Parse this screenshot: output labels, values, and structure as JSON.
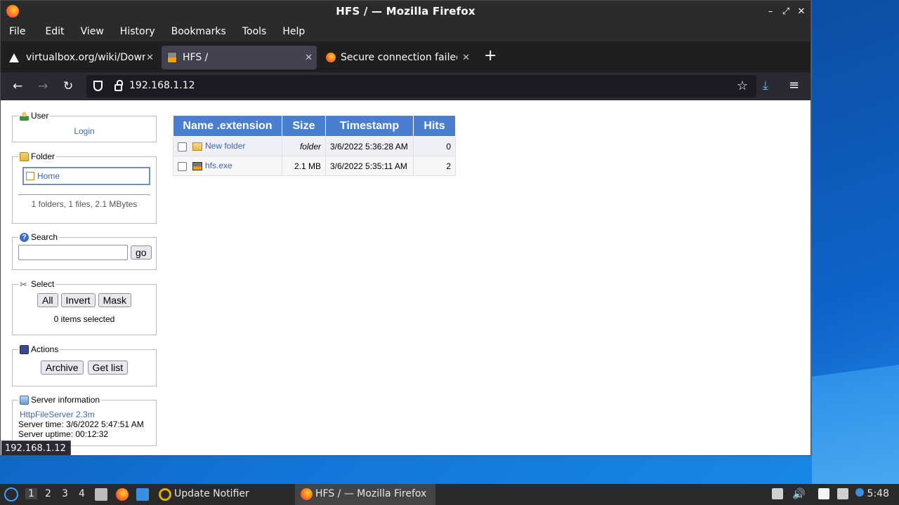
{
  "window": {
    "title": "HFS / — Mozilla Firefox"
  },
  "menu": [
    "File",
    "Edit",
    "View",
    "History",
    "Bookmarks",
    "Tools",
    "Help"
  ],
  "tabs": [
    {
      "label": "virtualbox.org/wiki/Downl"
    },
    {
      "label": "HFS /"
    },
    {
      "label": "Secure connection failed"
    }
  ],
  "address": {
    "url": "192.168.1.12"
  },
  "sidebar": {
    "user": {
      "legend": "User",
      "login": "Login"
    },
    "folder": {
      "legend": "Folder",
      "home": "Home",
      "summary": "1 folders, 1 files, 2.1 MBytes"
    },
    "search": {
      "legend": "Search",
      "go": "go"
    },
    "select": {
      "legend": "Select",
      "all": "All",
      "invert": "Invert",
      "mask": "Mask",
      "status": "0 items selected"
    },
    "actions": {
      "legend": "Actions",
      "archive": "Archive",
      "getlist": "Get list"
    },
    "server": {
      "legend": "Server information",
      "name": "HttpFileServer 2.3m",
      "time": "Server time: 3/6/2022 5:47:51 AM",
      "uptime": "Server uptime: 00:12:32"
    }
  },
  "table": {
    "headers": [
      "Name .extension",
      "Size",
      "Timestamp",
      "Hits"
    ],
    "rows": [
      {
        "name": "New folder",
        "size": "folder",
        "timestamp": "3/6/2022 5:36:28 AM",
        "hits": "0"
      },
      {
        "name": "hfs.exe",
        "size": "2.1 MB",
        "timestamp": "3/6/2022 5:35:11 AM",
        "hits": "2"
      }
    ]
  },
  "status_url": "192.168.1.12",
  "taskbar": {
    "workspaces": [
      "1",
      "2",
      "3",
      "4"
    ],
    "update_notifier": "Update Notifier",
    "firefox_window": "HFS / — Mozilla Firefox",
    "clock": "5:48"
  }
}
